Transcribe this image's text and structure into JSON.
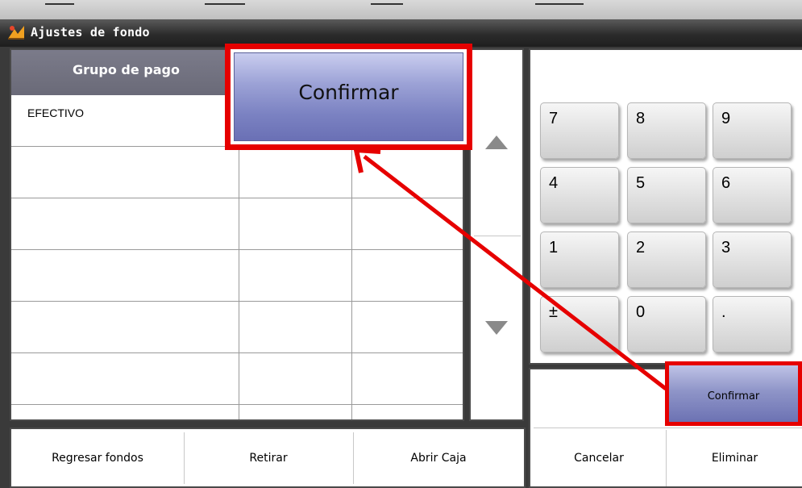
{
  "window": {
    "title": "Ajustes de fondo"
  },
  "grid": {
    "header": "Grupo de pago",
    "rows": [
      "EFECTIVO",
      "",
      "",
      "",
      "",
      ""
    ]
  },
  "numpad": {
    "keys": [
      "7",
      "8",
      "9",
      "4",
      "5",
      "6",
      "1",
      "2",
      "3",
      "±",
      "0",
      "."
    ]
  },
  "actions": {
    "confirm_label": "Confirmar",
    "cancel_label": "Cancelar",
    "delete_label": "Eliminar"
  },
  "bottom_bar": {
    "return_funds_label": "Regresar fondos",
    "withdraw_label": "Retirar",
    "open_register_label": "Abrir Caja"
  },
  "callout": {
    "zoom_label": "Confirmar"
  },
  "colors": {
    "highlight": "#e60000",
    "button_accent": "#7b82c2",
    "title_bar": "#2c2c2c"
  }
}
